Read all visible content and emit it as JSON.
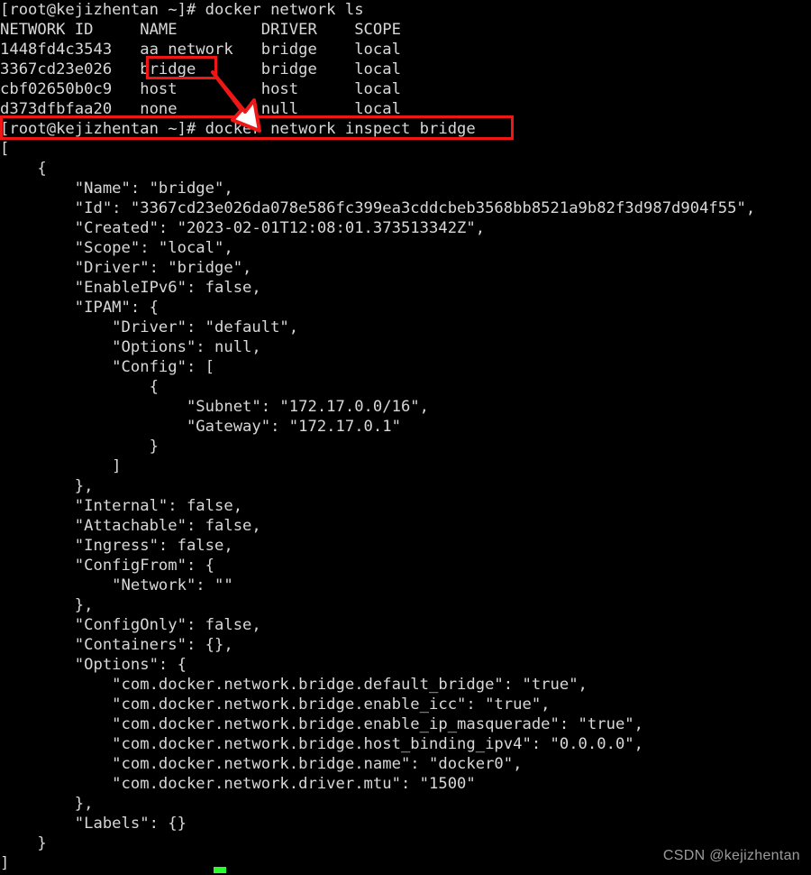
{
  "terminal": {
    "prompt": "[root@kejizhentan ~]# ",
    "commands": {
      "list_networks": "docker network ls",
      "inspect_bridge": "docker network inspect bridge"
    },
    "line_01": "[root@kejizhentan ~]# docker network ls",
    "line_02": "NETWORK ID     NAME         DRIVER    SCOPE",
    "line_03": "1448fd4c3543   aa network   bridge    local",
    "line_04": "3367cd23e026   bridge       bridge    local",
    "line_05": "cbf02650b0c9   host         host      local",
    "line_06": "d373dfbfaa20   none         null      local",
    "line_07": "[root@kejizhentan ~]# docker network inspect bridge",
    "line_08": "[",
    "line_09": "    {",
    "line_10": "        \"Name\": \"bridge\",",
    "line_11": "        \"Id\": \"3367cd23e026da078e586fc399ea3cddcbeb3568bb8521a9b82f3d987d904f55\",",
    "line_12": "        \"Created\": \"2023-02-01T12:08:01.373513342Z\",",
    "line_13": "        \"Scope\": \"local\",",
    "line_14": "        \"Driver\": \"bridge\",",
    "line_15": "        \"EnableIPv6\": false,",
    "line_16": "        \"IPAM\": {",
    "line_17": "            \"Driver\": \"default\",",
    "line_18": "            \"Options\": null,",
    "line_19": "            \"Config\": [",
    "line_20": "                {",
    "line_21": "                    \"Subnet\": \"172.17.0.0/16\",",
    "line_22": "                    \"Gateway\": \"172.17.0.1\"",
    "line_23": "                }",
    "line_24": "            ]",
    "line_25": "        },",
    "line_26": "        \"Internal\": false,",
    "line_27": "        \"Attachable\": false,",
    "line_28": "        \"Ingress\": false,",
    "line_29": "        \"ConfigFrom\": {",
    "line_30": "            \"Network\": \"\"",
    "line_31": "        },",
    "line_32": "        \"ConfigOnly\": false,",
    "line_33": "        \"Containers\": {},",
    "line_34": "        \"Options\": {",
    "line_35": "            \"com.docker.network.bridge.default_bridge\": \"true\",",
    "line_36": "            \"com.docker.network.bridge.enable_icc\": \"true\",",
    "line_37": "            \"com.docker.network.bridge.enable_ip_masquerade\": \"true\",",
    "line_38": "            \"com.docker.network.bridge.host_binding_ipv4\": \"0.0.0.0\",",
    "line_39": "            \"com.docker.network.bridge.name\": \"docker0\",",
    "line_40": "            \"com.docker.network.driver.mtu\": \"1500\"",
    "line_41": "        },",
    "line_42": "        \"Labels\": {}",
    "line_43": "    }",
    "line_44": "]"
  },
  "network_table": {
    "headers": [
      "NETWORK ID",
      "NAME",
      "DRIVER",
      "SCOPE"
    ],
    "rows": [
      {
        "id": "1448fd4c3543",
        "name": "aa network",
        "driver": "bridge",
        "scope": "local"
      },
      {
        "id": "3367cd23e026",
        "name": "bridge",
        "driver": "bridge",
        "scope": "local"
      },
      {
        "id": "cbf02650b0c9",
        "name": "host",
        "driver": "host",
        "scope": "local"
      },
      {
        "id": "d373dfbfaa20",
        "name": "none",
        "driver": "null",
        "scope": "local"
      }
    ]
  },
  "inspect_result": {
    "Name": "bridge",
    "Id": "3367cd23e026da078e586fc399ea3cddcbeb3568bb8521a9b82f3d987d904f55",
    "Created": "2023-02-01T12:08:01.373513342Z",
    "Scope": "local",
    "Driver": "bridge",
    "EnableIPv6": "false",
    "IPAM": {
      "Driver": "default",
      "Options": "null",
      "Config": [
        {
          "Subnet": "172.17.0.0/16",
          "Gateway": "172.17.0.1"
        }
      ]
    },
    "Internal": "false",
    "Attachable": "false",
    "Ingress": "false",
    "ConfigFrom": {
      "Network": ""
    },
    "ConfigOnly": "false",
    "Containers": "{}",
    "Options": {
      "com.docker.network.bridge.default_bridge": "true",
      "com.docker.network.bridge.enable_icc": "true",
      "com.docker.network.bridge.enable_ip_masquerade": "true",
      "com.docker.network.bridge.host_binding_ipv4": "0.0.0.0",
      "com.docker.network.bridge.name": "docker0",
      "com.docker.network.driver.mtu": "1500"
    },
    "Labels": "{}"
  },
  "annotations": {
    "highlight_color": "#ef1616",
    "arrow_fill": "#ffffff",
    "arrow_stroke": "#ef1616",
    "highlighted_cell": "bridge",
    "highlighted_command": "[root@kejizhentan ~]# docker network inspect bridge"
  },
  "watermark": {
    "text": "CSDN @kejizhentan",
    "color": "#9b9b9b"
  },
  "cursor": {
    "color": "#2bfc2b"
  }
}
